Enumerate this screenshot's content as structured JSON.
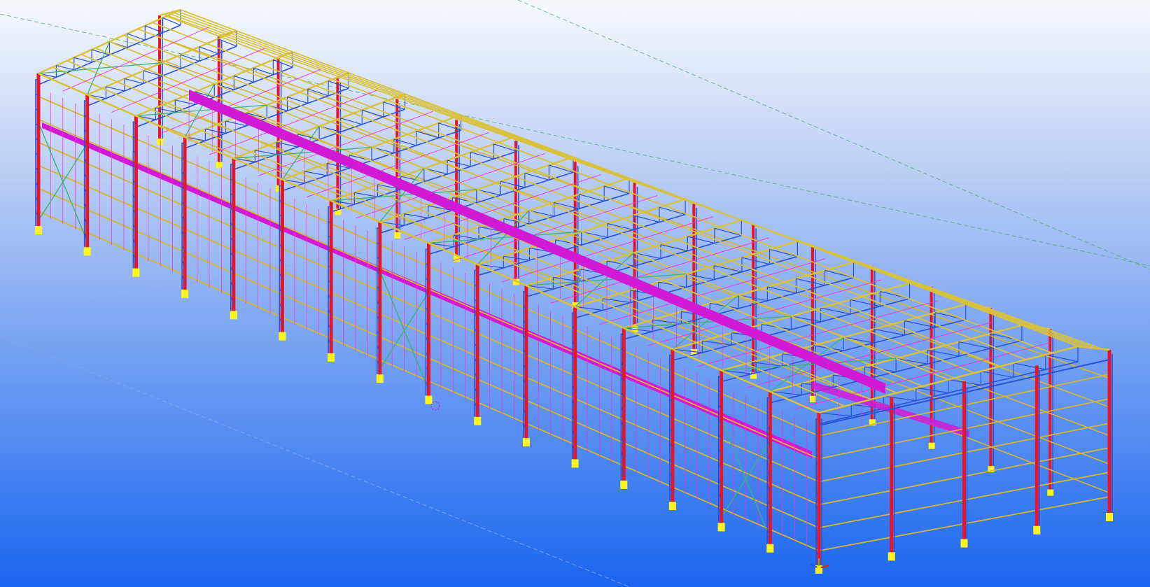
{
  "viewport": {
    "background_top": "#f7f9fd",
    "background_bottom": "#1a66f0"
  },
  "structure": {
    "bays": 16,
    "side_bays_front": 8,
    "front_wall_bays": 4,
    "girt_levels": 6,
    "colors": {
      "column": "#e8142a",
      "column_lacing": "#2a52d6",
      "base_plate": "#fff51c",
      "rafter": "#d9c23a",
      "girt": "#d6b630",
      "truss_web": "#2a52d6",
      "bracing_green": "#39b37a",
      "sag_rod": "#ff2bd0",
      "crane_girder": "#d21ad6",
      "grid_line": "#4fb070"
    }
  },
  "icons": {
    "work_plane": "work-plane-marker-icon",
    "coordinate_triad": "coordinate-axes-icon"
  }
}
